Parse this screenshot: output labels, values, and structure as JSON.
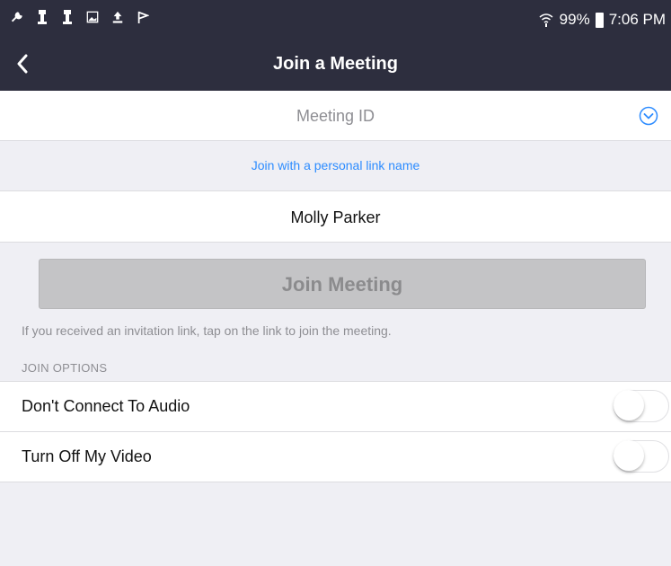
{
  "status_bar": {
    "icons_left": [
      "wrench-icon",
      "notification-icon",
      "notification-icon",
      "image-icon",
      "upload-icon",
      "flag-icon"
    ],
    "wifi_icon": "wifi-icon",
    "battery_percent": "99%",
    "battery_icon": "battery-icon",
    "time": "7:06 PM"
  },
  "nav": {
    "back_icon": "chevron-left-icon",
    "title": "Join a Meeting"
  },
  "meeting_id": {
    "placeholder": "Meeting ID",
    "value": "",
    "dropdown_icon": "chevron-down-circle-icon"
  },
  "personal_link": "Join with a personal link name",
  "name_field": {
    "value": "Molly Parker"
  },
  "join_button": "Join Meeting",
  "invitation_hint": "If you received an invitation link, tap on the link to join the meeting.",
  "join_options": {
    "header": "JOIN OPTIONS",
    "items": [
      {
        "label": "Don't Connect To Audio",
        "enabled": false
      },
      {
        "label": "Turn Off My Video",
        "enabled": false
      }
    ]
  },
  "colors": {
    "header_bg": "#2d2e3e",
    "accent": "#2d8cff",
    "background": "#efeff4",
    "button_disabled": "#c4c4c6"
  }
}
